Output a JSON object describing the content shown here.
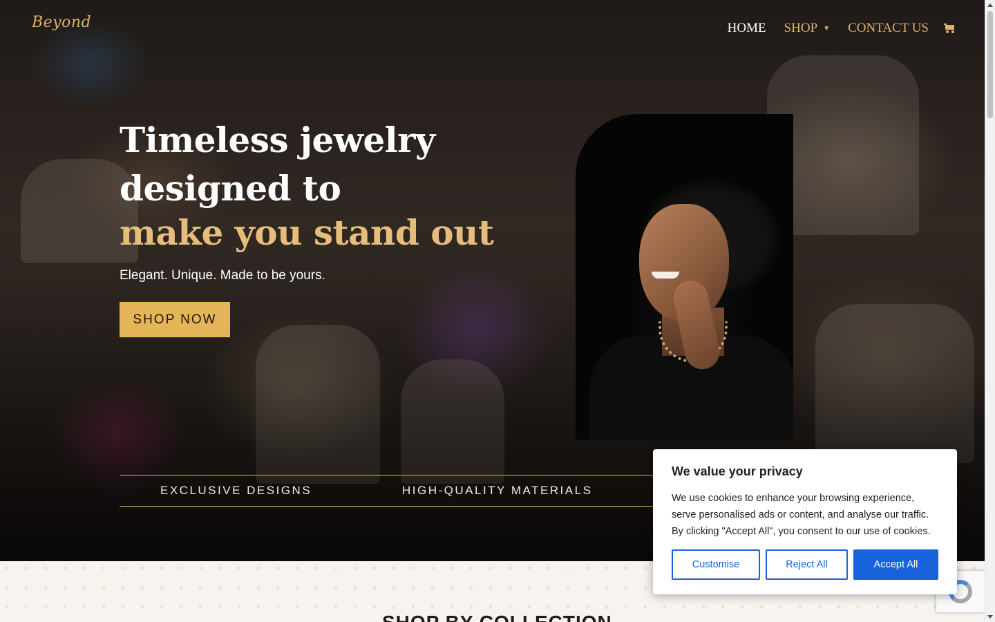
{
  "header": {
    "logo_text": "Beyond",
    "nav": [
      {
        "label": "HOME",
        "active": true
      },
      {
        "label": "SHOP",
        "has_dropdown": true
      },
      {
        "label": "CONTACT US"
      }
    ],
    "cart_icon": "cart-icon"
  },
  "hero": {
    "headline_line1": "Timeless jewelry",
    "headline_line2": "designed to",
    "headline_accent": "make you stand out",
    "tagline": "Elegant. Unique. Made to be yours.",
    "cta_label": "SHOP NOW"
  },
  "features": [
    "EXCLUSIVE DESIGNS",
    "HIGH-QUALITY MATERIALS"
  ],
  "collection": {
    "title": "SHOP BY COLLECTION"
  },
  "cookie": {
    "title": "We value your privacy",
    "text": "We use cookies to enhance your browsing experience, serve personalised ads or content, and analyse our traffic. By clicking \"Accept All\", you consent to our use of cookies.",
    "customise_label": "Customise",
    "reject_label": "Reject All",
    "accept_label": "Accept All"
  },
  "colors": {
    "accent_gold": "#e5b55a",
    "heading_gold": "#e7bd7c",
    "cookie_blue": "#1863dc"
  }
}
